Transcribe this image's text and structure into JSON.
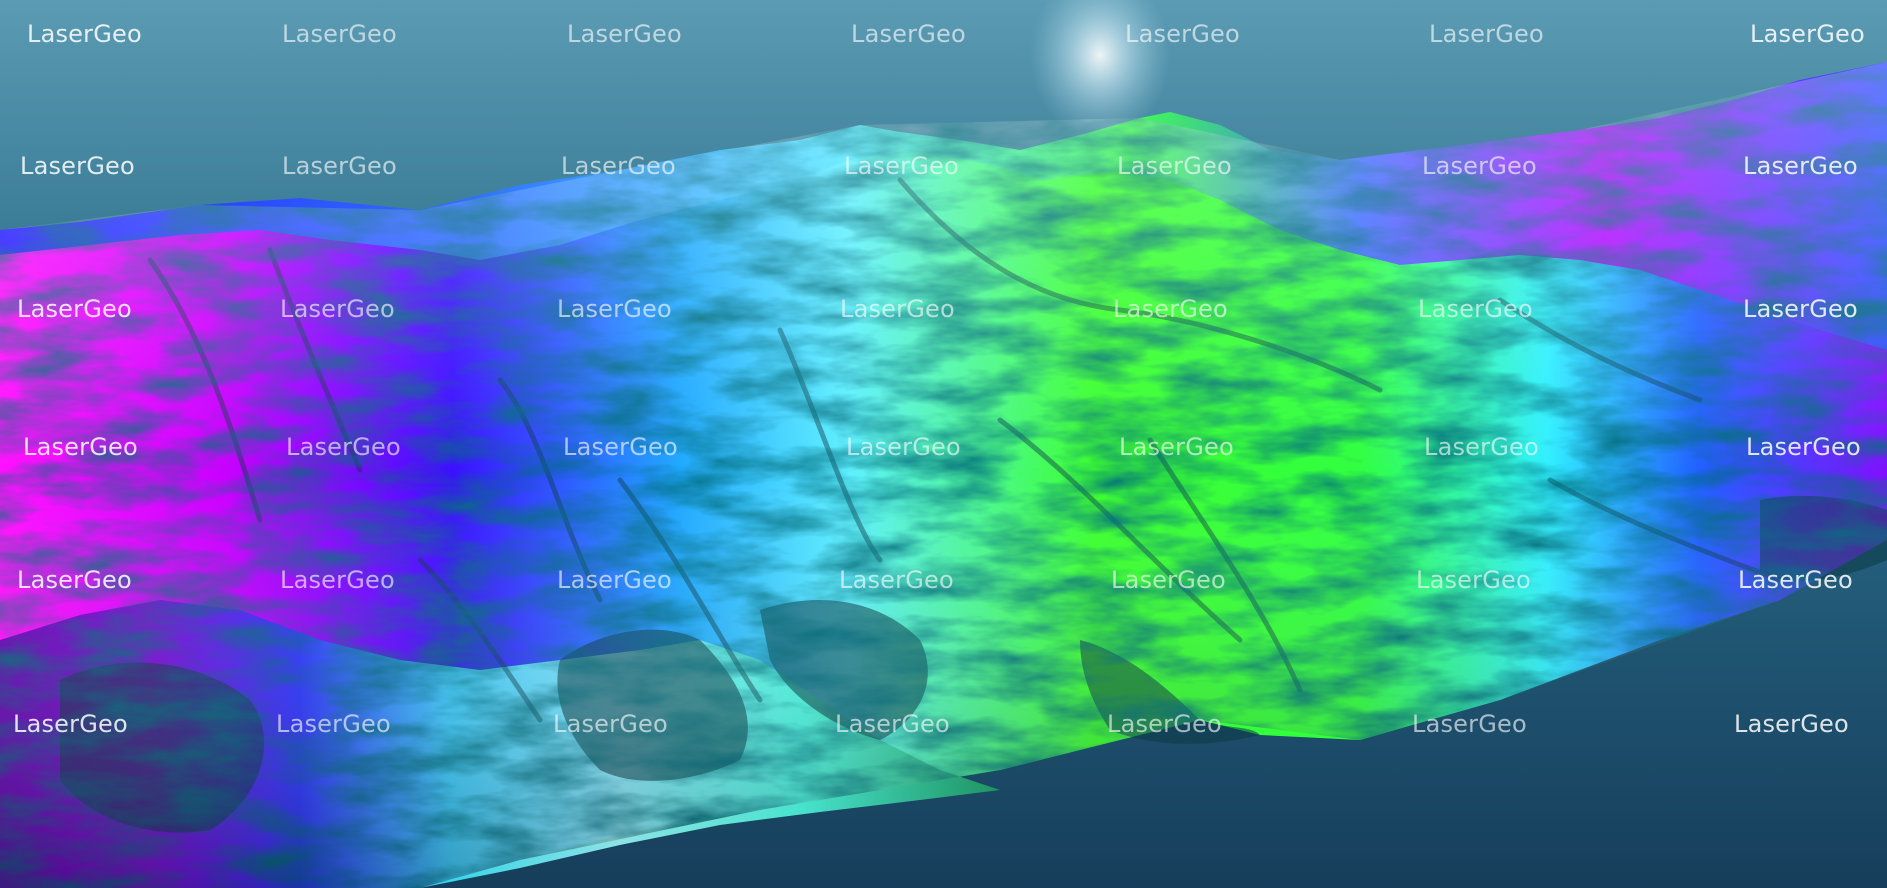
{
  "watermark": {
    "text": "LaserGeo",
    "rows": 6,
    "columns": 7
  },
  "colors": {
    "water_top": "#4d8ea6",
    "water_bottom": "#173f5c",
    "elevation_low": "#ff00ff",
    "elevation_mid_low": "#2a00ff",
    "elevation_mid": "#00e5ff",
    "elevation_high": "#33ff22",
    "shadow": "#0b3a44"
  }
}
